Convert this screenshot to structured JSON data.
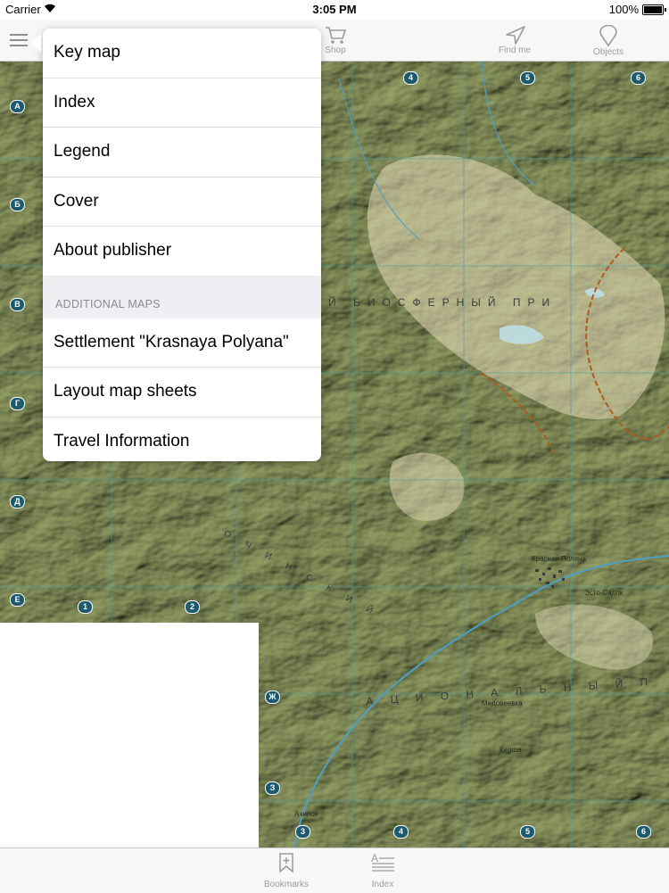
{
  "status_bar": {
    "carrier": "Carrier",
    "time": "3:05 PM",
    "battery": "100%"
  },
  "nav": {
    "shop_label": "Shop",
    "find_me_label": "Find me",
    "objects_label": "Objects"
  },
  "menu": {
    "items": [
      {
        "label": "Key map"
      },
      {
        "label": "Index"
      },
      {
        "label": "Legend"
      },
      {
        "label": "Cover"
      },
      {
        "label": "About publisher"
      }
    ],
    "section_header": "ADDITIONAL MAPS",
    "additional_items": [
      {
        "label": "Settlement \"Krasnaya Polyana\""
      },
      {
        "label": "Layout map sheets"
      },
      {
        "label": "Travel Information"
      }
    ]
  },
  "map": {
    "row_markers": [
      "А",
      "Б",
      "В",
      "Г",
      "Д",
      "Е",
      "Ж",
      "З"
    ],
    "col_markers_top": [
      "4",
      "5",
      "6"
    ],
    "col_markers_bottom": [
      "1",
      "2",
      "3",
      "4",
      "5",
      "6"
    ],
    "reserve_text_1": "Й БИОСФЕРНЫЙ ПРИ",
    "reserve_text_2": "А Ц И О Н А Л Ь Н Ы Й П",
    "reserve_text_3": "О Ч И Н С К И Й",
    "place_names": [
      "Красная Поляна",
      "Эсто-Садок",
      "Кепша",
      "Медовеевка",
      "Ачипсе"
    ],
    "colors": {
      "forest": "#8e9960",
      "highland": "#d8cfa3",
      "grid": "#4aa3a3"
    }
  },
  "tabbar": {
    "bookmarks_label": "Bookmarks",
    "index_label": "Index"
  }
}
